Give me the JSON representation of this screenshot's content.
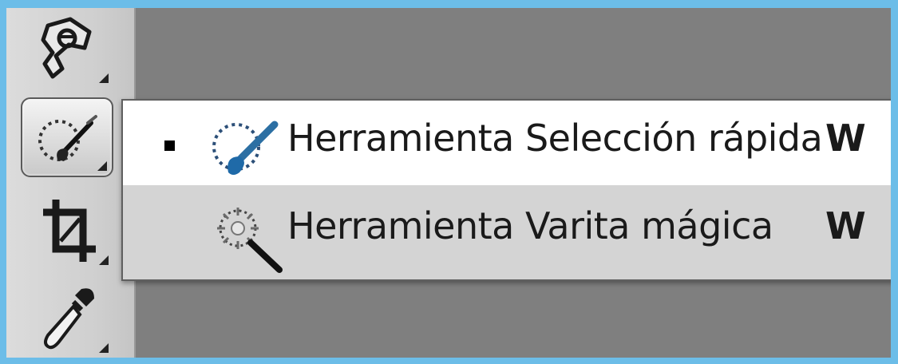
{
  "toolbar": {
    "tools": [
      {
        "icon": "polygon-lasso-tool-icon"
      },
      {
        "icon": "quick-selection-tool-icon",
        "active": true
      },
      {
        "icon": "crop-tool-icon"
      },
      {
        "icon": "eyedropper-tool-icon"
      }
    ]
  },
  "flyout": {
    "items": [
      {
        "label": "Herramienta Selección rápida",
        "shortcut": "W",
        "selected": true,
        "icon": "quick-selection-icon"
      },
      {
        "label": "Herramienta Varita mágica",
        "shortcut": "W",
        "selected": false,
        "icon": "magic-wand-icon"
      }
    ]
  },
  "colors": {
    "outer_border": "#6cbde8",
    "canvas": "#7f7f7f",
    "toolbar": "#d4d4d4",
    "selected_row": "#ffffff",
    "brush_blue": "#2c6fa3"
  }
}
